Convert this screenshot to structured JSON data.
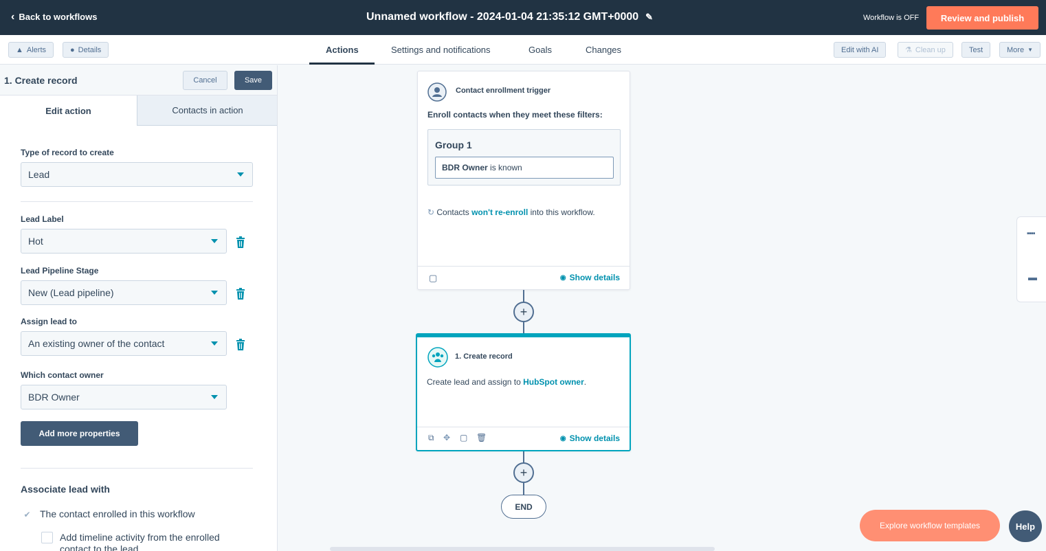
{
  "topbar": {
    "back_label": "Back to workflows",
    "title": "Unnamed workflow - 2024-01-04 21:35:12 GMT+0000",
    "status": "Workflow is OFF",
    "publish_label": "Review and publish"
  },
  "subnav": {
    "alerts_label": "Alerts",
    "details_label": "Details",
    "tabs": [
      "Actions",
      "Settings and notifications",
      "Goals",
      "Changes"
    ],
    "active_tab": "Actions",
    "edit_ai_label": "Edit with AI",
    "cleanup_label": "Clean up",
    "test_label": "Test",
    "more_label": "More"
  },
  "panel": {
    "title": "1. Create record",
    "cancel_label": "Cancel",
    "save_label": "Save",
    "tabs": [
      "Edit action",
      "Contacts in action"
    ],
    "fields": {
      "record_type": {
        "label": "Type of record to create",
        "value": "Lead"
      },
      "lead_label": {
        "label": "Lead Label",
        "value": "Hot"
      },
      "pipeline_stage": {
        "label": "Lead Pipeline Stage",
        "value": "New (Lead pipeline)"
      },
      "assign_to": {
        "label": "Assign lead to",
        "value": "An existing owner of the contact"
      },
      "contact_owner": {
        "label": "Which contact owner",
        "value": "BDR Owner"
      }
    },
    "add_properties_label": "Add more properties",
    "associate_title": "Associate lead with",
    "assoc_option_1": "The contact enrolled in this workflow",
    "assoc_option_2": "Add timeline activity from the enrolled contact to the lead"
  },
  "trigger_card": {
    "title": "Contact enrollment trigger",
    "subtitle": "Enroll contacts when they meet these filters:",
    "group_title": "Group 1",
    "filter_bold": "BDR Owner",
    "filter_rest": " is known",
    "reenroll_pre": "Contacts ",
    "reenroll_link": "won't re-enroll",
    "reenroll_post": " into this workflow.",
    "show_details": "Show details"
  },
  "action_card": {
    "title": "1. Create record",
    "text_pre": "Create lead and assign to ",
    "text_link": "HubSpot owner",
    "text_post": ".",
    "show_details": "Show details"
  },
  "end_label": "END",
  "explore_label": "Explore workflow templates",
  "help_label": "Help",
  "colors": {
    "topbar": "#213343",
    "accent_orange": "#ff7a59",
    "link_teal": "#0091ae",
    "action_border": "#00a4bd"
  }
}
